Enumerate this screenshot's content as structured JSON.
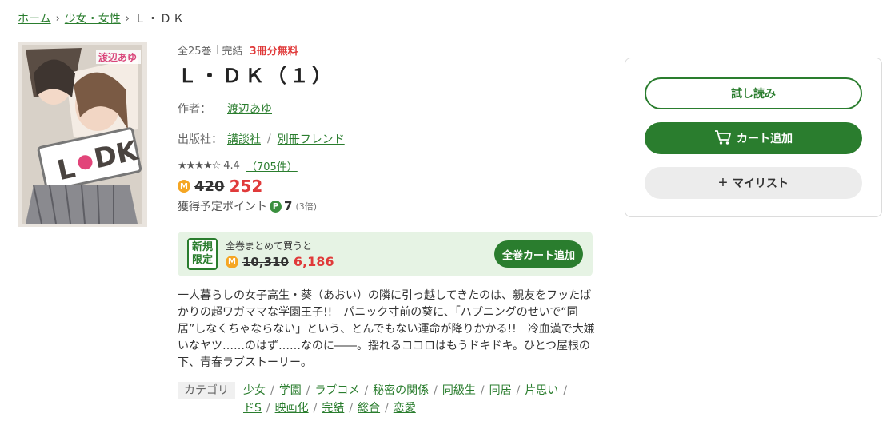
{
  "breadcrumb": {
    "home": "ホーム",
    "category": "少女・女性",
    "current": "Ｌ・ＤＫ"
  },
  "cover": {
    "author_text": "渡辺あゆ",
    "logo_text": "L DK"
  },
  "meta": {
    "volumes": "全25巻",
    "status": "完結",
    "free": "3冊分無料"
  },
  "title": "Ｌ・ＤＫ（１）",
  "author": {
    "label": "作者：",
    "name": "渡辺あゆ"
  },
  "publisher": {
    "label": "出版社：",
    "name": "講談社",
    "label_name": "別冊フレンド"
  },
  "rating": {
    "stars": "★★★★☆",
    "score": "4.4",
    "count": "（705件）"
  },
  "price": {
    "coin": "M",
    "original": "420",
    "sale": "252"
  },
  "points": {
    "label": "獲得予定ポイント",
    "icon": "P",
    "value": "7",
    "multiplier": "(3倍)"
  },
  "bundle": {
    "badge_line1": "新規",
    "badge_line2": "限定",
    "label": "全巻まとめて買うと",
    "original": "10,310",
    "sale": "6,186",
    "button": "全巻カート追加"
  },
  "description": "一人暮らしの女子高生・葵（あおい）の隣に引っ越してきたのは、親友をフッたばかりの超ワガママな学園王子!!　パニック寸前の葵に、「ハプニングのせいで“同居”しなくちゃならない」という、とんでもない運命が降りかかる!!　冷血漢で大嫌いなヤツ……のはず……なのに――。揺れるココロはもうドキドキ。ひとつ屋根の下、青春ラブストーリー。",
  "categories": {
    "label": "カテゴリ",
    "items": [
      "少女",
      "学園",
      "ラブコメ",
      "秘密の関係",
      "同級生",
      "同居",
      "片思い",
      "ドS",
      "映画化",
      "完結",
      "総合",
      "恋愛"
    ]
  },
  "actions": {
    "trial": "試し読み",
    "cart": "カート追加",
    "mylist": "マイリスト"
  },
  "colors": {
    "accent": "#2a7d2e",
    "sale": "#e03a3a",
    "coin": "#f5a623",
    "bundle_bg": "#e6f3e4"
  }
}
